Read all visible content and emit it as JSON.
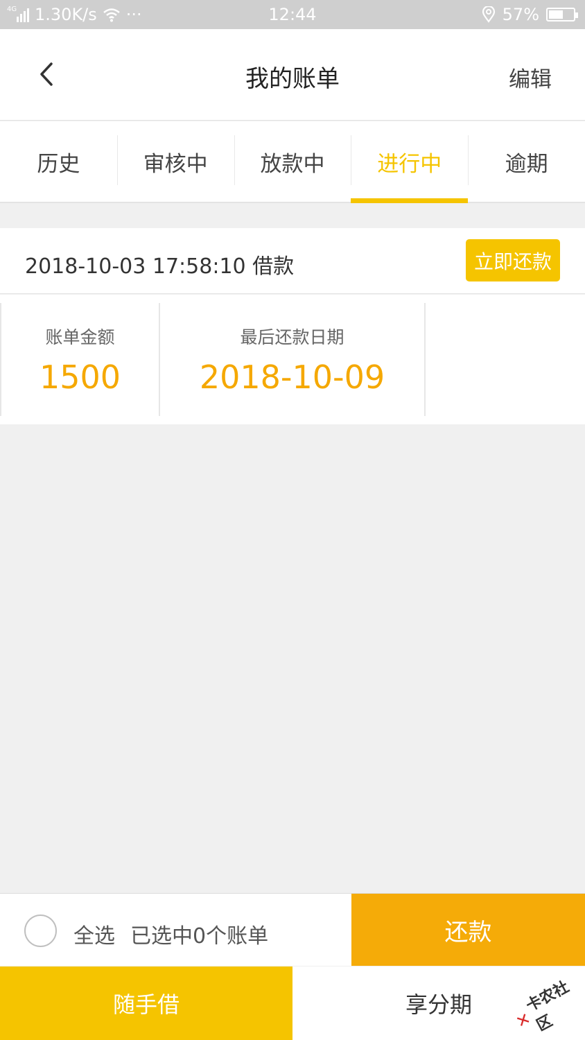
{
  "status_bar": {
    "network": "4G",
    "speed": "1.30K/s",
    "more": "···",
    "time": "12:44",
    "battery": "57%"
  },
  "header": {
    "title": "我的账单",
    "edit_label": "编辑",
    "back_icon": "chevron-left-icon"
  },
  "tabs": [
    {
      "label": "历史",
      "active": false
    },
    {
      "label": "审核中",
      "active": false
    },
    {
      "label": "放款中",
      "active": false
    },
    {
      "label": "进行中",
      "active": true
    },
    {
      "label": "逾期",
      "active": false
    }
  ],
  "bill": {
    "datetime": "2018-10-03 17:58:10",
    "type": "借款",
    "pay_now_label": "立即还款",
    "amount_label": "账单金额",
    "amount": "1500",
    "due_label": "最后还款日期",
    "due_date": "2018-10-09"
  },
  "select_bar": {
    "select_all_label": "全选",
    "selected_text": "已选中0个账单",
    "repay_label": "还款"
  },
  "bottom_nav": {
    "item1": "随手借",
    "item2": "享分期"
  },
  "watermark": {
    "text": "卡农社区"
  },
  "colors": {
    "accent": "#f5c400",
    "repay": "#f5ab08",
    "value": "#f5a800",
    "status_bar": "#cfcfcf"
  }
}
